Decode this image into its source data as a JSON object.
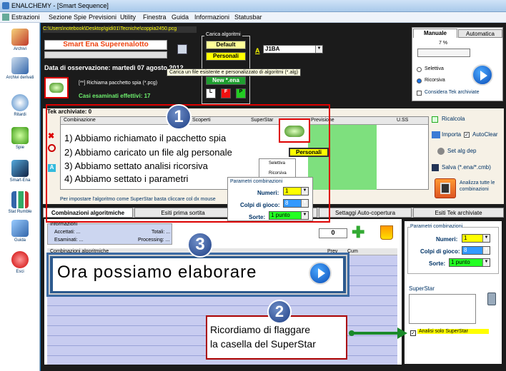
{
  "window": {
    "title": "ENALCHEMY - [Smart Sequence]"
  },
  "menu": [
    "Estrazioni",
    "Sezione Spie",
    "Previsioni",
    "Utility",
    "Finestra",
    "Guida",
    "Informazioni",
    "Statusbar"
  ],
  "sidebar": [
    {
      "label": "Archivi"
    },
    {
      "label": "Archivi derivati"
    },
    {
      "label": "Ritardi"
    },
    {
      "label": "Spie"
    },
    {
      "label": "Smart-Ena"
    },
    {
      "label": "Stat Rumble"
    },
    {
      "label": "Guida"
    },
    {
      "label": "Esci"
    }
  ],
  "top": {
    "path": "C:\\Users\\notebook\\Desktop\\gidi01\\Tecniche\\coppia2450.pcg",
    "game": "Smart Ena Superenalotto",
    "date": "Data di osservazione:  martedì 07 agosto 2012",
    "pcg": "[**] Richiama pacchetto spia (*.pcg)",
    "casi": "Casi esaminati effettivi: 17",
    "alg_title": "Carica algoritmi",
    "alg_default": "Default",
    "alg_personali": "Personali",
    "alg_new": "New *.ena",
    "alg_l": "L",
    "alg_f": "F",
    "alg_p": "P",
    "a_label": "A",
    "sel_value": "J1BA",
    "tooltip": "Carica un file esistente e personalizzato di algoritmi (*.alg)"
  },
  "mode": {
    "tab_manual": "Manuale",
    "tab_auto": "Automatica",
    "percent": "7 %",
    "opt_selettiva": "Selettiva",
    "opt_ricorsiva": "Ricorsiva",
    "considera": "Considera Tek archiviate"
  },
  "tek": {
    "title": "Tek archiviate: 0",
    "col_combinazione": "Combinazione",
    "col_scoperti": "Scoperti",
    "col_superstar": "SuperStar",
    "col_previsione": "Previsione",
    "col_uss": "U.SS",
    "footer_note": "Per impostare l'algoritmo come SuperStar basta cliccare col dx mouse",
    "a_btn": "A"
  },
  "steps": {
    "s1": "1) Abbiamo richiamato il pacchetto spia",
    "s2": "2) Abbiamo caricato un file alg personale",
    "s3": "3) Abbiamo settato analisi ricorsiva",
    "s4": "4) Abbiamo settato i parametri",
    "personali": "Personali"
  },
  "mini_params": {
    "title": "Parametri combinazioni",
    "numeri_label": "Numeri:",
    "numeri": "1",
    "colpi_label": "Colpi di gioco:",
    "colpi": "8",
    "sorte_label": "Sorte:",
    "sorte": "1 punto",
    "opt_selettiva": "Selettiva",
    "opt_ricorsiva": "Ricorsiva"
  },
  "right_actions": {
    "ricalcola": "Ricalcola",
    "importa": "Importa",
    "autoclear": "AutoClear",
    "setalg": "Set alg dep",
    "salva": "Salva (*.ena/*.cmb)",
    "analizza": "Analizza tutte le combinazioni"
  },
  "tabs": [
    "Combinazioni algoritmiche",
    "Esiti prima sortita",
    "",
    "Settaggi Auto-copertura",
    "Esiti Tek archiviate"
  ],
  "info": {
    "title": "Informazioni",
    "accettati": "Accettati: ...",
    "totali": "Totali: ...",
    "esaminati": "Esaminati: ...",
    "processing": "Processing: ...",
    "count": "0",
    "grid_header": "Combinazioni algoritmiche",
    "col_prev": "Prev",
    "col_cum": "Cum"
  },
  "callout3": "Ora possiamo elaborare",
  "params": {
    "title": "Parametri combinazioni",
    "numeri_label": "Numeri:",
    "numeri": "1",
    "colpi_label": "Colpi di gioco:",
    "colpi": "8",
    "sorte_label": "Sorte:",
    "sorte": "1 punto",
    "superstar": "SuperStar",
    "analisi": "Analisi solo SuperStar"
  },
  "callout2": {
    "line1": "Ricordiamo di flaggare",
    "line2": "la casella del SuperStar"
  },
  "badges": {
    "b1": "1",
    "b2": "2",
    "b3": "3"
  }
}
